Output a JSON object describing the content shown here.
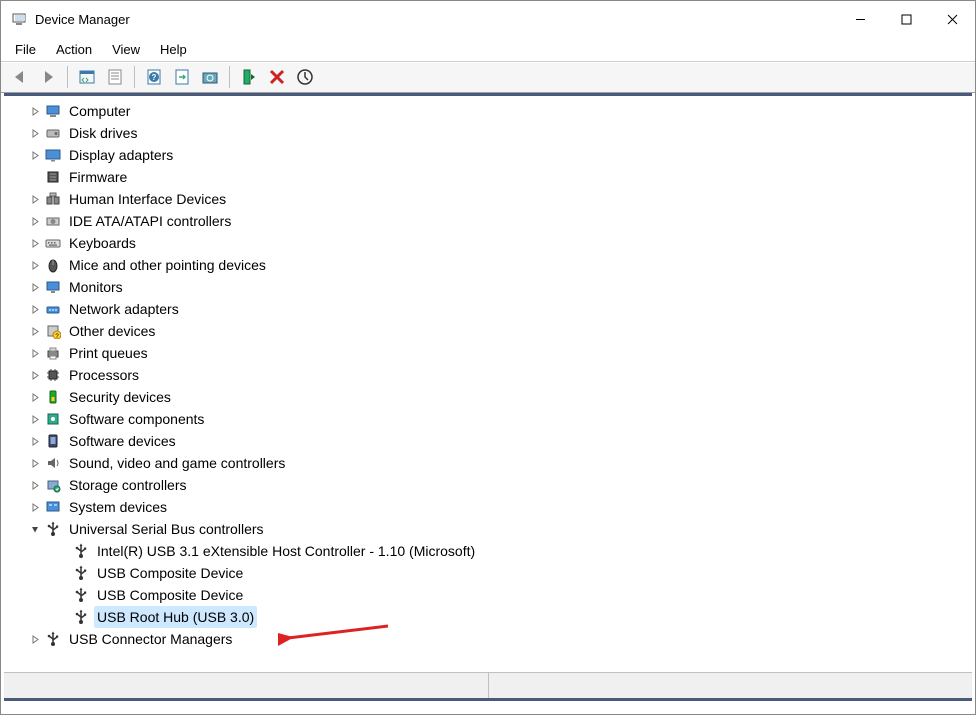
{
  "window": {
    "title": "Device Manager"
  },
  "menu": {
    "file": "File",
    "action": "Action",
    "view": "View",
    "help": "Help"
  },
  "tree": [
    {
      "level": 0,
      "exp": "collapsed",
      "icon": "computer",
      "label": "Computer"
    },
    {
      "level": 0,
      "exp": "collapsed",
      "icon": "disk",
      "label": "Disk drives"
    },
    {
      "level": 0,
      "exp": "collapsed",
      "icon": "display",
      "label": "Display adapters"
    },
    {
      "level": 0,
      "exp": "none",
      "icon": "firmware",
      "label": "Firmware"
    },
    {
      "level": 0,
      "exp": "collapsed",
      "icon": "hid",
      "label": "Human Interface Devices"
    },
    {
      "level": 0,
      "exp": "collapsed",
      "icon": "ide",
      "label": "IDE ATA/ATAPI controllers"
    },
    {
      "level": 0,
      "exp": "collapsed",
      "icon": "keyboard",
      "label": "Keyboards"
    },
    {
      "level": 0,
      "exp": "collapsed",
      "icon": "mouse",
      "label": "Mice and other pointing devices"
    },
    {
      "level": 0,
      "exp": "collapsed",
      "icon": "monitor",
      "label": "Monitors"
    },
    {
      "level": 0,
      "exp": "collapsed",
      "icon": "network",
      "label": "Network adapters"
    },
    {
      "level": 0,
      "exp": "collapsed",
      "icon": "other",
      "label": "Other devices"
    },
    {
      "level": 0,
      "exp": "collapsed",
      "icon": "printer",
      "label": "Print queues"
    },
    {
      "level": 0,
      "exp": "collapsed",
      "icon": "cpu",
      "label": "Processors"
    },
    {
      "level": 0,
      "exp": "collapsed",
      "icon": "security",
      "label": "Security devices"
    },
    {
      "level": 0,
      "exp": "collapsed",
      "icon": "component",
      "label": "Software components"
    },
    {
      "level": 0,
      "exp": "collapsed",
      "icon": "swdev",
      "label": "Software devices"
    },
    {
      "level": 0,
      "exp": "collapsed",
      "icon": "sound",
      "label": "Sound, video and game controllers"
    },
    {
      "level": 0,
      "exp": "collapsed",
      "icon": "storage",
      "label": "Storage controllers"
    },
    {
      "level": 0,
      "exp": "collapsed",
      "icon": "system",
      "label": "System devices"
    },
    {
      "level": 0,
      "exp": "expanded",
      "icon": "usb",
      "label": "Universal Serial Bus controllers"
    },
    {
      "level": 1,
      "exp": "none",
      "icon": "usb",
      "label": "Intel(R) USB 3.1 eXtensible Host Controller - 1.10 (Microsoft)"
    },
    {
      "level": 1,
      "exp": "none",
      "icon": "usb",
      "label": "USB Composite Device"
    },
    {
      "level": 1,
      "exp": "none",
      "icon": "usb",
      "label": "USB Composite Device"
    },
    {
      "level": 1,
      "exp": "none",
      "icon": "usb",
      "label": "USB Root Hub (USB 3.0)",
      "selected": true
    },
    {
      "level": 0,
      "exp": "collapsed",
      "icon": "usb",
      "label": "USB Connector Managers"
    }
  ]
}
